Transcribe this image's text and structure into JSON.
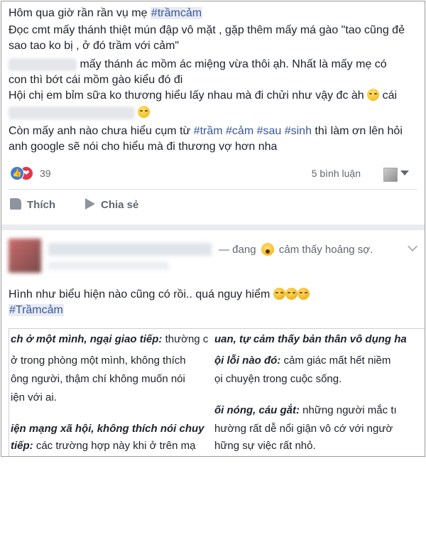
{
  "post1": {
    "line1_text": "Hôm qua giờ rần rần vụ mẹ ",
    "line1_tag": "#trầmcảm",
    "line2": "Đọc cmt mấy thánh thiệt mún đập vô mặt , gặp thêm mấy má gào \"tao cũng đẻ",
    "line3": "sao tao ko bị , ở đó trầm với cảm\"",
    "line4": "mấy thánh ác mồm ác miệng vừa thôi ạh. Nhất là mấy mẹ có",
    "line5": "con thì bớt cái mồm gào kiểu đó đi",
    "line6_text": "Hội chị em bỉm sữa ko thương hiểu lấy nhau mà đi chửi như vậy đc àh ",
    "line6_tail": " cái",
    "line8_pre": "Còn mấy anh nào chưa hiểu cụm từ ",
    "line8_tags": "#trầm #cảm #sau #sinh",
    "line8_post": " thì làm ơn lên hỏi",
    "line9": "anh google sẽ nói cho hiểu mà đi thương vợ hơn nha",
    "reaction_count": "39",
    "comments": "5 bình luận",
    "like_label": "Thích",
    "share_label": "Chia sẻ"
  },
  "post2": {
    "feeling_pre": "— đang",
    "feeling_post": "cảm thấy hoảng sợ.",
    "text_line1": "Hình như biểu hiện nào cũng có rồi.. quá nguy hiểm ",
    "hashtag": "#Trầmcảm",
    "image_left": {
      "l1_bold": "ch ở một mình, ngại giao tiếp:",
      "l1_rest": " thường c",
      "l2": " ở trong phòng một mình, không thích",
      "l3": "ông người, thậm chí không muốn nói",
      "l4": "iện với ai.",
      "l5_bold": "iện mạng xã hội, không thích nói chuy",
      "l6_bold": "tiếp:",
      "l6_rest": " các trường hợp này khi ở trên mạ"
    },
    "image_right": {
      "l1_bold": "uan, tự cảm thấy bản thân vô dụng ha",
      "l2_bold": "ội lỗi nào đó:",
      "l2_rest": " cảm giác mất hết niềm",
      "l3": "ọi chuyện trong cuộc sống.",
      "l4_bold": "ối nóng, cáu gắt:",
      "l4_rest": " những người mắc tı",
      "l5": "hường rất dễ nổi giận vô cớ với ngườ",
      "l6": "hững sự việc rất nhỏ."
    }
  },
  "colors": {
    "link": "#365899",
    "like": "#3b7dd8",
    "love": "#e5364b",
    "muted": "#616770"
  }
}
